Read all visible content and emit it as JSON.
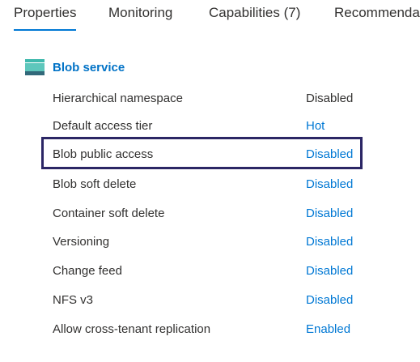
{
  "tabs": [
    {
      "label": "Properties",
      "active": true
    },
    {
      "label": "Monitoring",
      "active": false
    },
    {
      "label": "Capabilities (7)",
      "active": false
    },
    {
      "label": "Recommenda",
      "active": false
    }
  ],
  "section": {
    "title": "Blob service",
    "icon": "blob-service-icon"
  },
  "rows": [
    {
      "label": "Hierarchical namespace",
      "value": "Disabled",
      "is_link": false
    },
    {
      "label": "Default access tier",
      "value": "Hot",
      "is_link": true
    },
    {
      "label": "Blob public access",
      "value": "Disabled",
      "is_link": true,
      "highlighted": true
    },
    {
      "label": "Blob soft delete",
      "value": "Disabled",
      "is_link": true
    },
    {
      "label": "Container soft delete",
      "value": "Disabled",
      "is_link": true
    },
    {
      "label": "Versioning",
      "value": "Disabled",
      "is_link": true
    },
    {
      "label": "Change feed",
      "value": "Disabled",
      "is_link": true
    },
    {
      "label": "NFS v3",
      "value": "Disabled",
      "is_link": true
    },
    {
      "label": "Allow cross-tenant replication",
      "value": "Enabled",
      "is_link": true
    }
  ],
  "colors": {
    "accent": "#0078d4",
    "highlight_border": "#2b2665",
    "icon_teal": "#3fb9ad",
    "icon_dark": "#32697a"
  }
}
